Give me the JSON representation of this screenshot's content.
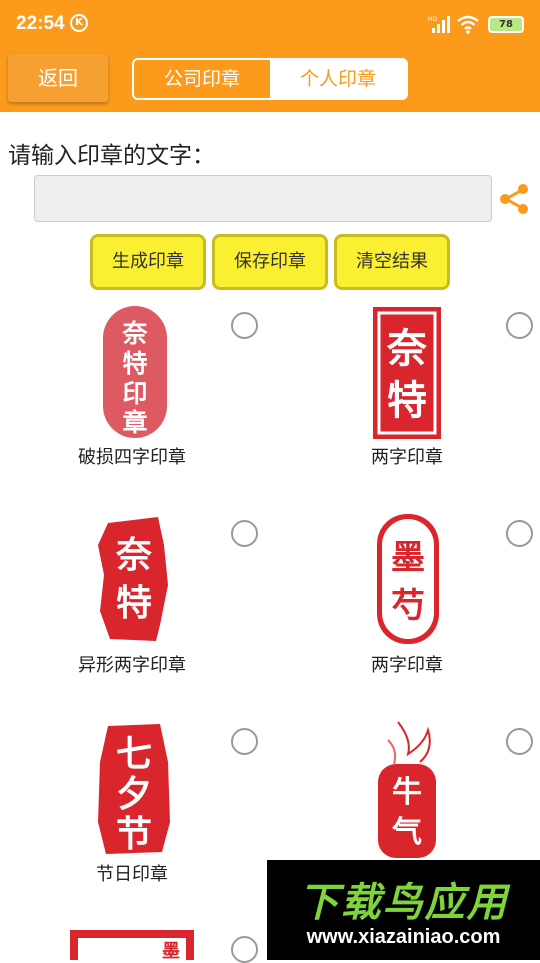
{
  "status": {
    "time": "22:54",
    "k_badge": "K",
    "battery": "78"
  },
  "header": {
    "back_label": "返回",
    "tabs": [
      {
        "label": "公司印章"
      },
      {
        "label": "个人印章"
      }
    ]
  },
  "form": {
    "prompt": "请输入印章的文字：",
    "input_value": "",
    "input_placeholder": ""
  },
  "actions": {
    "generate": "生成印章",
    "save": "保存印章",
    "clear": "清空结果"
  },
  "seals": [
    {
      "label": "破损四字印章",
      "text": "奈特印章"
    },
    {
      "label": "两字印章",
      "text": "奈特"
    },
    {
      "label": "异形两字印章",
      "text": "奈特"
    },
    {
      "label": "两字印章",
      "text": "墨芍"
    },
    {
      "label": "节日印章",
      "text": "七夕节"
    },
    {
      "label": "",
      "text": "牛气"
    }
  ],
  "watermark": {
    "title": "下载鸟应用",
    "url": "www.xiazainiao.com"
  },
  "colors": {
    "accent": "#fb9a1b",
    "button_yellow": "#fbef32",
    "seal_red": "#d8262c"
  }
}
